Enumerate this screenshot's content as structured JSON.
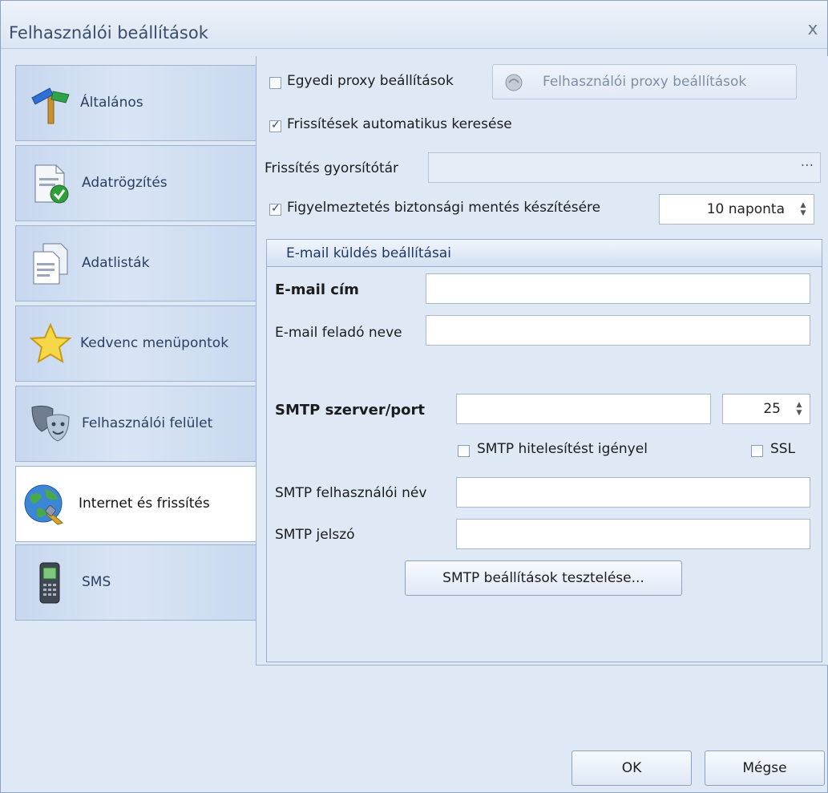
{
  "window": {
    "title": "Felhasználói beállítások",
    "close_glyph": "x"
  },
  "nav": {
    "items": [
      {
        "label": "Általános",
        "icon": "signpost-icon",
        "active": false
      },
      {
        "label": "Adatrögzítés",
        "icon": "document-check-icon",
        "active": false
      },
      {
        "label": "Adatlisták",
        "icon": "documents-icon",
        "active": false
      },
      {
        "label": "Kedvenc menüpontok",
        "icon": "star-icon",
        "active": false
      },
      {
        "label": "Felhasználói felület",
        "icon": "masks-icon",
        "active": false
      },
      {
        "label": "Internet és frissítés",
        "icon": "globe-plug-icon",
        "active": true
      },
      {
        "label": "SMS",
        "icon": "mobile-phone-icon",
        "active": false
      }
    ]
  },
  "proxy": {
    "checkbox_label": "Egyedi proxy beállítások",
    "checked": false,
    "button_label": "Felhasználói proxy beállítások"
  },
  "auto_update": {
    "label": "Frissítések automatikus keresése",
    "checked": true
  },
  "update_cache": {
    "label": "Frissítés gyorsítótár",
    "value": "",
    "browse_label": "···"
  },
  "backup_warning": {
    "label": "Figyelmeztetés biztonsági mentés készítésére",
    "checked": true,
    "value": "10 naponta"
  },
  "email": {
    "group_title": "E-mail küldés beállításai",
    "address_label": "E-mail cím",
    "address_value": "",
    "sender_label": "E-mail feladó neve",
    "sender_value": "",
    "smtp_label": "SMTP szerver/port",
    "smtp_server_value": "",
    "smtp_port_value": "25",
    "auth_label": "SMTP hitelesítést igényel",
    "auth_checked": false,
    "ssl_label": "SSL",
    "ssl_checked": false,
    "user_label": "SMTP felhasználói név",
    "user_value": "",
    "password_label": "SMTP jelszó",
    "password_value": "",
    "test_button": "SMTP beállítások tesztelése..."
  },
  "footer": {
    "ok_label": "OK",
    "cancel_label": "Mégse"
  }
}
